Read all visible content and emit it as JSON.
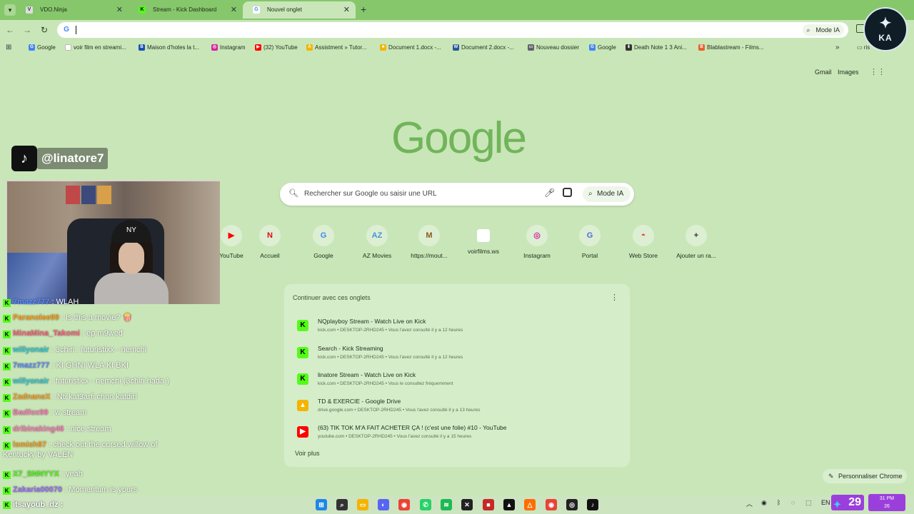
{
  "tabs": [
    {
      "title": "VDO.Ninja",
      "favicon": "V",
      "color": "#333333"
    },
    {
      "title": "Stream - Kick Dashboard",
      "favicon": "K",
      "color": "#53fc18"
    },
    {
      "title": "Nouvel onglet",
      "favicon": "G",
      "color": "#4285f4"
    }
  ],
  "toolbar": {
    "mode_ia": "Mode IA"
  },
  "bookmarks": [
    {
      "label": "Google",
      "icon": "G",
      "color": "#4285f4"
    },
    {
      "label": "voir film en streami...",
      "icon": "",
      "color": "#ffffff"
    },
    {
      "label": "Maison d'hotes la t...",
      "icon": "B",
      "color": "#1a4fb3"
    },
    {
      "label": "Instagram",
      "icon": "◎",
      "color": "#d6249f"
    },
    {
      "label": "(32) YouTube",
      "icon": "▶",
      "color": "#ff0000"
    },
    {
      "label": "Assistment » Tutor...",
      "icon": "A",
      "color": "#f4b400"
    },
    {
      "label": "Document 1.docx -...",
      "icon": "■",
      "color": "#f4b400"
    },
    {
      "label": "Document 2.docx -...",
      "icon": "W",
      "color": "#2b579a"
    },
    {
      "label": "Nouveau dossier",
      "icon": "▭",
      "color": "#5f6368"
    },
    {
      "label": "Google",
      "icon": "G",
      "color": "#4285f4"
    },
    {
      "label": "Death Note 1 3 Ani...",
      "icon": "⬇",
      "color": "#333333"
    },
    {
      "label": "Blablastream - Films...",
      "icon": "B",
      "color": "#e8612c"
    }
  ],
  "bookmarks_more": "»",
  "bookmarks_all": "ris",
  "top_links": {
    "gmail": "Gmail",
    "images": "Images"
  },
  "google_logo": "Google",
  "search": {
    "placeholder": "Rechercher sur Google ou saisir une URL",
    "mode_ia": "Mode IA"
  },
  "shortcuts": [
    {
      "label": "YouTube",
      "icon": "▶",
      "color": "#ff0000"
    },
    {
      "label": "Accueil",
      "icon": "N",
      "color": "#e50914"
    },
    {
      "label": "Google",
      "icon": "G",
      "color": "#4285f4"
    },
    {
      "label": "AZ Movies",
      "icon": "AZ",
      "color": "#4a90d9"
    },
    {
      "label": "https://mout...",
      "icon": "M",
      "color": "#8b5a1b"
    },
    {
      "label": "voirfilms.ws",
      "icon": "",
      "color": "#ffffff"
    },
    {
      "label": "Instagram",
      "icon": "◎",
      "color": "#d6249f"
    },
    {
      "label": "Portal",
      "icon": "G",
      "color": "#4a6fd9"
    },
    {
      "label": "Web Store",
      "icon": "◓",
      "color": "#ea4335"
    },
    {
      "label": "Ajouter un ra...",
      "icon": "+",
      "color": "#333333"
    }
  ],
  "continue": {
    "title": "Continuer avec ces onglets",
    "items": [
      {
        "title": "NQplayboy Stream - Watch Live on Kick",
        "sub": "kick.com • DESKTOP-2RHD245 • Vous l'avez consulté il y a 12 heures",
        "icon": "K",
        "color": "#53fc18"
      },
      {
        "title": "Search - Kick Streaming",
        "sub": "kick.com • DESKTOP-2RHD245 • Vous l'avez consulté il y a 12 heures",
        "icon": "K",
        "color": "#53fc18"
      },
      {
        "title": "linatore Stream - Watch Live on Kick",
        "sub": "kick.com • DESKTOP-2RHD245 • Vous le consultez fréquemment",
        "icon": "K",
        "color": "#53fc18"
      },
      {
        "title": "TD & EXERCIE - Google Drive",
        "sub": "drive.google.com • DESKTOP-2RHD245 • Vous l'avez consulté il y a 13 heures",
        "icon": "▲",
        "color": "#f4b400"
      },
      {
        "title": "(63) TIK TOK M'A FAIT ACHETER ÇA ! (c'est une folie) #10 - YouTube",
        "sub": "youtube.com • DESKTOP-2RHD245 • Vous l'avez consulté il y a 15 heures",
        "icon": "▶",
        "color": "#ff0000"
      }
    ],
    "more": "Voir plus"
  },
  "customize": "Personnaliser Chrome",
  "overlay": {
    "tiktok_handle": "@linatore7",
    "channel_logo_letters": "KA"
  },
  "chat": [
    {
      "user": "7mazz777",
      "msg": ": WLAH",
      "color": "#5a8cff"
    },
    {
      "user": "Paranolee99",
      "msg": ": Is this a movie? 🍿",
      "color": "#ff9f1a"
    },
    {
      "user": "MinaMina_Takomi",
      "msg": ": ep m9wed",
      "color": "#ff5e7a"
    },
    {
      "user": "willyonair",
      "msg": ": 3chiri : futuristixx - nemchi",
      "color": "#2ecbd6"
    },
    {
      "user": "7mazz777",
      "msg": ": KI GHNI WLA KI BKI",
      "color": "#5a8cff"
    },
    {
      "user": "willyonair",
      "msg": ": futuristicx - nemchi (3chiri hada )",
      "color": "#2ecbd6"
    },
    {
      "user": "ZadnaneX",
      "msg": ": Nti kat3arfi chno katdiri",
      "color": "#ff9f1a"
    },
    {
      "user": "Badfox99",
      "msg": ": w stream",
      "color": "#ff7ab8"
    },
    {
      "user": "dribinaking46",
      "msg": ": nice stream",
      "color": "#ff7ab8"
    },
    {
      "user": "lsmish87",
      "msg": ": check out the cursed willow of",
      "color": "#ff9f1a"
    },
    {
      "user": "X7_SNNYYX",
      "msg": ": yeah",
      "color": "#53fc18"
    },
    {
      "user": "Zakaria00070",
      "msg": ": Momentum is yours",
      "color": "#9b6cff"
    }
  ],
  "chat_wrap": "Kentucky by VALEN",
  "chat_bottom_user": "itsayoub_dz :",
  "taskbar": {
    "viewers": "29",
    "time": "31 PM",
    "date": "26"
  },
  "colors": {
    "page_bg": "#c9e6b8",
    "tabstrip": "#86c76b",
    "kick_green": "#53fc18",
    "overlay_purple": "#9b3fdc"
  }
}
